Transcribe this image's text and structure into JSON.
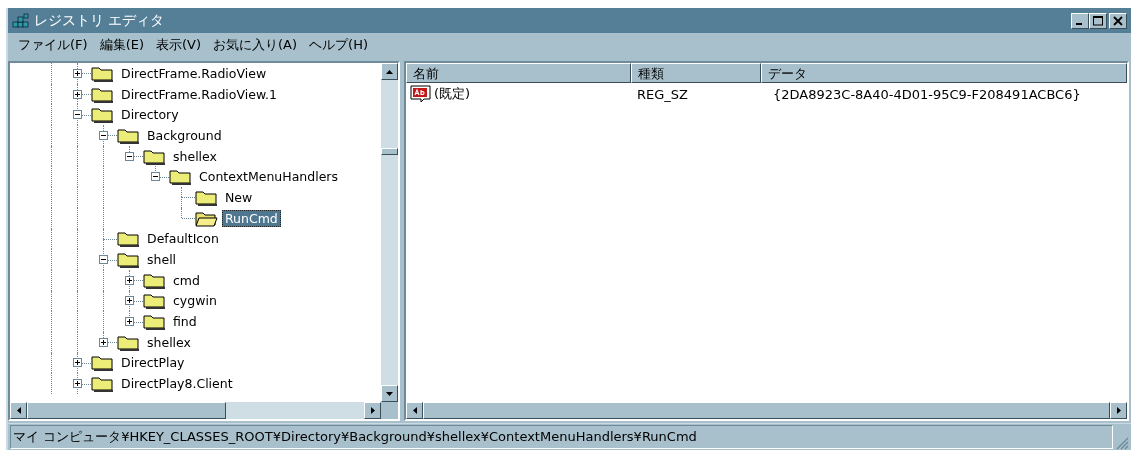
{
  "window": {
    "title": "レジストリ エディタ"
  },
  "menu": [
    {
      "label": "ファイル(F)"
    },
    {
      "label": "編集(E)"
    },
    {
      "label": "表示(V)"
    },
    {
      "label": "お気に入り(A)"
    },
    {
      "label": "ヘルプ(H)"
    }
  ],
  "tree": {
    "items": [
      {
        "name": "DirectFrame.RadioView",
        "has_children": true,
        "expanded": false,
        "selected": false
      },
      {
        "name": "DirectFrame.RadioView.1",
        "has_children": true,
        "expanded": false,
        "selected": false
      },
      {
        "name": "Directory",
        "has_children": true,
        "expanded": true,
        "selected": false,
        "children": [
          {
            "name": "Background",
            "has_children": true,
            "expanded": true,
            "selected": false,
            "children": [
              {
                "name": "shellex",
                "has_children": true,
                "expanded": true,
                "selected": false,
                "children": [
                  {
                    "name": "ContextMenuHandlers",
                    "has_children": true,
                    "expanded": true,
                    "selected": false,
                    "children": [
                      {
                        "name": "New",
                        "has_children": false,
                        "selected": false
                      },
                      {
                        "name": "RunCmd",
                        "has_children": false,
                        "selected": true
                      }
                    ]
                  }
                ]
              }
            ]
          },
          {
            "name": "DefaultIcon",
            "has_children": false,
            "selected": false
          },
          {
            "name": "shell",
            "has_children": true,
            "expanded": true,
            "selected": false,
            "children": [
              {
                "name": "cmd",
                "has_children": true,
                "expanded": false,
                "selected": false
              },
              {
                "name": "cygwin",
                "has_children": true,
                "expanded": false,
                "selected": false
              },
              {
                "name": "find",
                "has_children": true,
                "expanded": false,
                "selected": false
              }
            ]
          },
          {
            "name": "shellex",
            "has_children": true,
            "expanded": false,
            "selected": false
          }
        ]
      },
      {
        "name": "DirectPlay",
        "has_children": true,
        "expanded": false,
        "selected": false
      },
      {
        "name": "DirectPlay8.Client",
        "has_children": true,
        "expanded": false,
        "selected": false
      }
    ]
  },
  "values": {
    "columns": [
      "名前",
      "種類",
      "データ"
    ],
    "rows": [
      {
        "name": "(既定)",
        "type": "REG_SZ",
        "data": "{2DA8923C-8A40-4D01-95C9-F208491ACBC6}"
      }
    ]
  },
  "status_bar": "マイ コンピュータ¥HKEY_CLASSES_ROOT¥Directory¥Background¥shellex¥ContextMenuHandlers¥RunCmd"
}
